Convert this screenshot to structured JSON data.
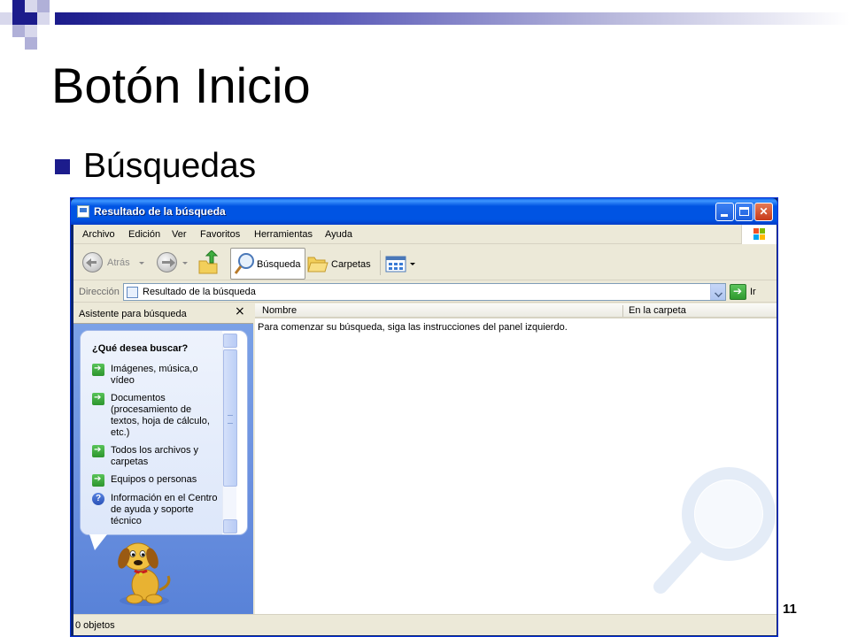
{
  "slide": {
    "title": "Botón Inicio",
    "bullet": "Búsquedas",
    "page_number": "11"
  },
  "window": {
    "title": "Resultado de la búsqueda",
    "buttons": {
      "minimize": "",
      "maximize": "",
      "close": "✕"
    }
  },
  "menu": {
    "items": [
      "Archivo",
      "Edición",
      "Ver",
      "Favoritos",
      "Herramientas",
      "Ayuda"
    ]
  },
  "toolbar": {
    "back_label": "Atrás",
    "search_label": "Búsqueda",
    "folders_label": "Carpetas"
  },
  "address": {
    "label": "Dirección",
    "value": "Resultado de la búsqueda",
    "go_label": "Ir"
  },
  "assistant": {
    "header": "Asistente para búsqueda",
    "close": "×",
    "question": "¿Qué desea buscar?",
    "options": [
      "Imágenes, música,o vídeo",
      "Documentos (procesamiento de textos, hoja de cálculo, etc.)",
      "Todos los archivos y carpetas",
      "Equipos o personas",
      "Información en el Centro de ayuda y soporte técnico"
    ]
  },
  "results": {
    "columns": [
      "Nombre",
      "En la carpeta"
    ],
    "message": "Para comenzar su búsqueda, siga las instrucciones del panel izquierdo."
  },
  "status": {
    "text": "0 objetos"
  },
  "colors": {
    "accent": "#1c1c8c",
    "titlebar": "#0054e3",
    "pane_blue": "#6d92e0"
  }
}
